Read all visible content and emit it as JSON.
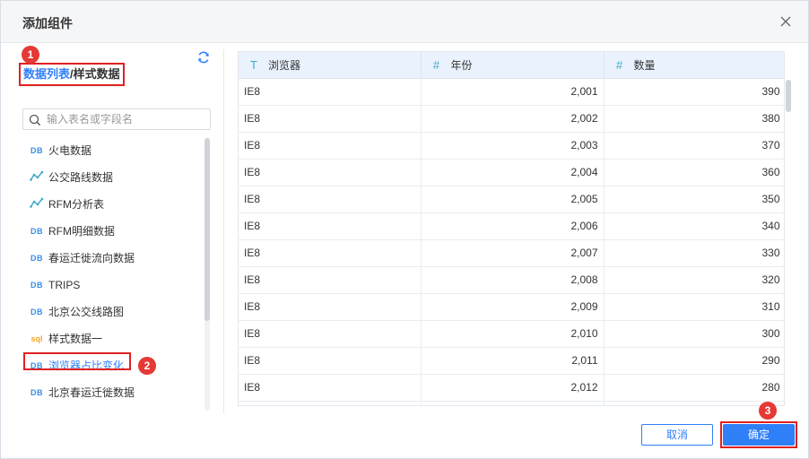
{
  "dialog": {
    "title": "添加组件"
  },
  "left": {
    "breadcrumb": {
      "active": "数据列表",
      "sep": "/",
      "current": "样式数据"
    },
    "search": {
      "placeholder": "输入表名或字段名",
      "value": ""
    },
    "items": [
      {
        "icon": "DB",
        "icon_name": "db-icon",
        "label": "火电数据"
      },
      {
        "icon": "line",
        "icon_name": "line-chart-icon",
        "label": "公交路线数据"
      },
      {
        "icon": "line",
        "icon_name": "line-chart-icon",
        "label": "RFM分析表"
      },
      {
        "icon": "DB",
        "icon_name": "db-icon",
        "label": "RFM明细数据"
      },
      {
        "icon": "DB",
        "icon_name": "db-icon",
        "label": "春运迁徙流向数据"
      },
      {
        "icon": "DB",
        "icon_name": "db-icon",
        "label": "TRIPS"
      },
      {
        "icon": "DB",
        "icon_name": "db-icon",
        "label": "北京公交线路图"
      },
      {
        "icon": "sql",
        "icon_name": "sql-icon",
        "label": "样式数据一"
      },
      {
        "icon": "DB",
        "icon_name": "db-icon",
        "label": "浏览器占比变化"
      },
      {
        "icon": "DB",
        "icon_name": "db-icon",
        "label": "北京春运迁徙数据"
      }
    ],
    "selected_index": 8
  },
  "table": {
    "columns": [
      {
        "type_icon": "T",
        "label": "浏览器"
      },
      {
        "type_icon": "#",
        "label": "年份"
      },
      {
        "type_icon": "#",
        "label": "数量"
      }
    ],
    "rows": [
      [
        "IE8",
        "2,001",
        "390"
      ],
      [
        "IE8",
        "2,002",
        "380"
      ],
      [
        "IE8",
        "2,003",
        "370"
      ],
      [
        "IE8",
        "2,004",
        "360"
      ],
      [
        "IE8",
        "2,005",
        "350"
      ],
      [
        "IE8",
        "2,006",
        "340"
      ],
      [
        "IE8",
        "2,007",
        "330"
      ],
      [
        "IE8",
        "2,008",
        "320"
      ],
      [
        "IE8",
        "2,009",
        "310"
      ],
      [
        "IE8",
        "2,010",
        "300"
      ],
      [
        "IE8",
        "2,011",
        "290"
      ],
      [
        "IE8",
        "2,012",
        "280"
      ],
      [
        "",
        "",
        ""
      ]
    ]
  },
  "footer": {
    "cancel_label": "取消",
    "ok_label": "确定"
  },
  "badges": [
    "1",
    "2",
    "3"
  ],
  "colors": {
    "accent": "#2f7ff8",
    "highlight": "#e02020",
    "badge": "#e53935",
    "header_bg": "#eaf2fd"
  }
}
